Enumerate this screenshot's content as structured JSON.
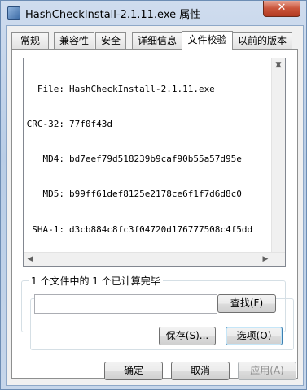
{
  "window": {
    "title": "HashCheckInstall-2.1.11.exe 属性",
    "close_label": "✕"
  },
  "tabs": [
    {
      "label": "常规"
    },
    {
      "label": "兼容性"
    },
    {
      "label": "安全"
    },
    {
      "label": "详细信息"
    },
    {
      "label": "文件校验",
      "active": true
    },
    {
      "label": "以前的版本"
    }
  ],
  "hashes": [
    {
      "key": "File:",
      "value": "HashCheckInstall-2.1.11.exe"
    },
    {
      "key": "CRC-32:",
      "value": "77f0f43d"
    },
    {
      "key": "MD4:",
      "value": "bd7eef79d518239b9caf90b55a57d95e"
    },
    {
      "key": "MD5:",
      "value": "b99ff61def8125e2178ce6f1f7d6d8c0"
    },
    {
      "key": "SHA-1:",
      "value": "d3cb884c8fc3f04720d176777508c4f5dd"
    }
  ],
  "status": {
    "label": "1 个文件中的 1 个已计算完毕",
    "search_value": "",
    "find_button": "查找(F)"
  },
  "actions": {
    "save": "保存(S)...",
    "options": "选项(O)"
  },
  "footer": {
    "ok": "确定",
    "cancel": "取消",
    "apply": "应用(A)"
  }
}
